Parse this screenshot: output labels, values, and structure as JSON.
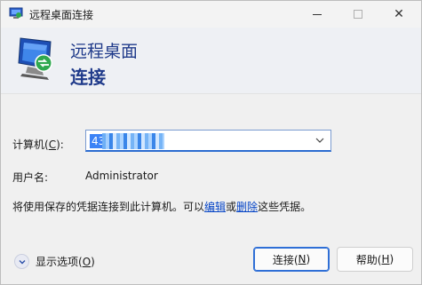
{
  "window": {
    "title": "远程桌面连接",
    "header_line1": "远程桌面",
    "header_line2": "连接"
  },
  "form": {
    "computer_label_pre": "计算机(",
    "computer_label_key": "C",
    "computer_label_post": "):",
    "computer_value": "43.",
    "user_label": "用户名:",
    "user_value": "Administrator"
  },
  "info": {
    "pre": "将使用保存的凭据连接到此计算机。可以",
    "edit_link": "编辑",
    "or": "或",
    "delete_link": "删除",
    "post": "这些凭据。"
  },
  "footer": {
    "options_pre": "显示选项(",
    "options_key": "O",
    "options_post": ")",
    "connect_pre": "连接(",
    "connect_key": "N",
    "connect_post": ")",
    "help_pre": "帮助(",
    "help_key": "H",
    "help_post": ")"
  },
  "colors": {
    "header_text": "#1f3a8a",
    "link": "#0645c6",
    "selection": "#3b82f6"
  }
}
